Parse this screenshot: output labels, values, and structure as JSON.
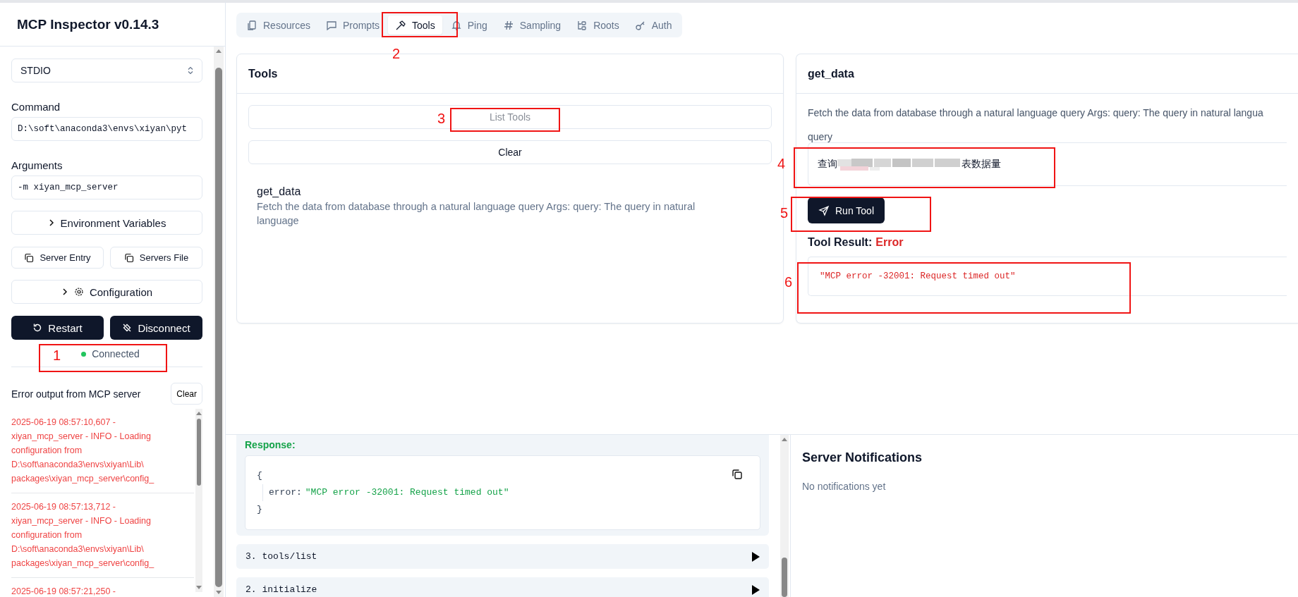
{
  "sidebar": {
    "title": "MCP Inspector v0.14.3",
    "transport": {
      "value": "STDIO"
    },
    "command": {
      "label": "Command",
      "value": "D:\\soft\\anaconda3\\envs\\xiyan\\pyt"
    },
    "arguments": {
      "label": "Arguments",
      "value": "-m xiyan_mcp_server"
    },
    "env_button": "Environment Variables",
    "server_entry": "Server Entry",
    "servers_file": "Servers File",
    "configuration": "Configuration",
    "restart": "Restart",
    "disconnect": "Disconnect",
    "status": {
      "text": "Connected",
      "connected": true
    },
    "error_output": {
      "title": "Error output from MCP server",
      "clear": "Clear",
      "entries": [
        {
          "lines": [
            "2025-06-19 08:57:10,607 -",
            "xiyan_mcp_server - INFO - Loading",
            "configuration from",
            "D:\\soft\\anaconda3\\envs\\xiyan\\Lib\\",
            "packages\\xiyan_mcp_server\\config_"
          ]
        },
        {
          "lines": [
            "2025-06-19 08:57:13,712 -",
            "xiyan_mcp_server - INFO - Loading",
            "configuration from",
            "D:\\soft\\anaconda3\\envs\\xiyan\\Lib\\",
            "packages\\xiyan_mcp_server\\config_"
          ]
        },
        {
          "lines": [
            "2025-06-19 08:57:21,250 -"
          ]
        }
      ]
    }
  },
  "tabs": [
    {
      "label": "Resources",
      "selected": false
    },
    {
      "label": "Prompts",
      "selected": false
    },
    {
      "label": "Tools",
      "selected": true
    },
    {
      "label": "Ping",
      "selected": false
    },
    {
      "label": "Sampling",
      "selected": false
    },
    {
      "label": "Roots",
      "selected": false
    },
    {
      "label": "Auth",
      "selected": false
    }
  ],
  "tools_panel": {
    "title": "Tools",
    "list_button": {
      "label": "List Tools",
      "disabled": true
    },
    "clear_button": "Clear",
    "tools": [
      {
        "name": "get_data",
        "description": "Fetch the data from database through a natural language query Args: query: The query in natural language"
      }
    ]
  },
  "tool_detail": {
    "title": "get_data",
    "description": "Fetch the data from database through a natural language query Args: query: The query in natural langua",
    "param_label": "query",
    "value_start": "查询",
    "value_end": "表数据量",
    "run_button": "Run Tool",
    "result_label": "Tool Result:",
    "result_status": {
      "text": "Error",
      "kind": "error"
    },
    "result_text": "\"MCP error -32001: Request timed out\""
  },
  "history": {
    "response_label": "Response:",
    "open": "{",
    "key": "error:",
    "value": "\"MCP error -32001: Request timed out\"",
    "close": "}",
    "items": [
      {
        "label": "3. tools/list",
        "expanded": false
      },
      {
        "label": "2. initialize",
        "expanded": false
      }
    ]
  },
  "notifications": {
    "title": "Server Notifications",
    "empty": "No notifications yet"
  },
  "annotations": [
    {
      "label": "1"
    },
    {
      "label": "2"
    },
    {
      "label": "3"
    },
    {
      "label": "4"
    },
    {
      "label": "5"
    },
    {
      "label": "6"
    }
  ]
}
